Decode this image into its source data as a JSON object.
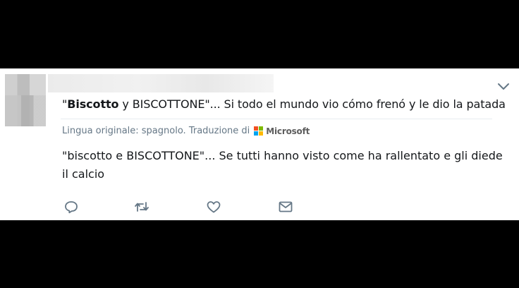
{
  "tweet": {
    "original_bold": "Biscotto",
    "original_quote_open": "\"",
    "original_rest": " y BISCOTTONE\"... Si todo el mundo vio cómo frenó y le dio la patada",
    "translated_label": "Lingua originale: spagnolo. Traduzione di",
    "translator": "Microsoft",
    "translation_text": "\"biscotto e BISCOTTONE\"... Se tutti hanno visto come ha rallentato e gli diede il calcio"
  },
  "icons": {
    "more": "chevron-down-icon",
    "reply": "reply-icon",
    "retweet": "retweet-icon",
    "like": "heart-icon",
    "dm": "envelope-icon"
  },
  "colors": {
    "text": "#14171a",
    "secondary": "#657786",
    "icon": "#657786",
    "ms_red": "#f25022",
    "ms_green": "#7fba00",
    "ms_blue": "#00a4ef",
    "ms_yellow": "#ffb900"
  }
}
